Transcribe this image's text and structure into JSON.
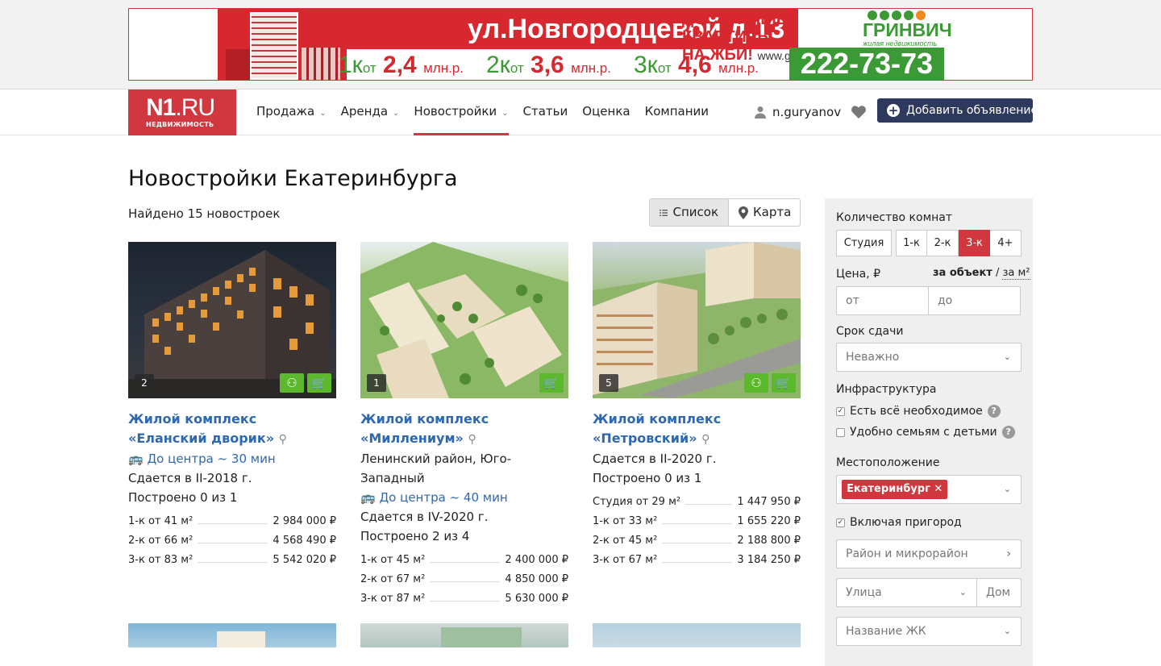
{
  "banner": {
    "address": "ул.Новгородцевой д.13",
    "promo_line1": "ДОСТУПНЫЕ КВАРТИРЫ",
    "promo_line2": "НА ЖБИ!",
    "url": "www.grinvich.ru",
    "brand": "ГРИНВИЧ",
    "brand_sub": "жилая недвижимость",
    "phone": "222-73-73",
    "prices": [
      {
        "rooms": "1к",
        "from": "от",
        "value": "2,4",
        "unit": "млн.р."
      },
      {
        "rooms": "2к",
        "from": "от",
        "value": "3,6",
        "unit": "млн.р."
      },
      {
        "rooms": "3к",
        "from": "от",
        "value": "4,6",
        "unit": "млн.р."
      }
    ]
  },
  "nav": {
    "logo_main": "N1",
    "logo_ru": ".RU",
    "logo_sub": "НЕДВИЖИМОСТЬ",
    "items": [
      {
        "label": "Продажа",
        "dropdown": true
      },
      {
        "label": "Аренда",
        "dropdown": true
      },
      {
        "label": "Новостройки",
        "dropdown": true,
        "active": true
      },
      {
        "label": "Статьи"
      },
      {
        "label": "Оценка"
      },
      {
        "label": "Компании"
      }
    ],
    "username": "n.guryanov",
    "add_button": "Добавить объявление"
  },
  "page": {
    "title": "Новостройки Екатеринбурга",
    "found": "Найдено 15 новостроек",
    "view_list": "Список",
    "view_map": "Карта"
  },
  "cards": [
    {
      "photo_count": "2",
      "name": "Жилой комплекс «Еланский дворик»",
      "district": "",
      "to_center": "До центра ~ 30 мин",
      "delivery": "Сдается в II-2018 г.",
      "built": "Построено 0 из 1",
      "prices": [
        {
          "label": "1-к от 41 м²",
          "price": "2 984 000 ₽"
        },
        {
          "label": "2-к от 66 м²",
          "price": "4 568 490 ₽"
        },
        {
          "label": "3-к от 83 м²",
          "price": "5 542 020 ₽"
        }
      ]
    },
    {
      "photo_count": "1",
      "name": "Жилой комплекс «Миллениум»",
      "district": "Ленинский район, Юго-Западный",
      "to_center": "До центра ~ 40 мин",
      "delivery": "Сдается в IV-2020 г.",
      "built": "Построено 2 из 4",
      "prices": [
        {
          "label": "1-к от 45 м²",
          "price": "2 400 000 ₽"
        },
        {
          "label": "2-к от 67 м²",
          "price": "4 850 000 ₽"
        },
        {
          "label": "3-к от 87 м²",
          "price": "5 630 000 ₽"
        }
      ]
    },
    {
      "photo_count": "5",
      "name": "Жилой комплекс «Петровский»",
      "district": "",
      "to_center": "",
      "delivery": "Сдается в II-2020 г.",
      "built": "Построено 0 из 1",
      "prices": [
        {
          "label": "Студия от 29 м²",
          "price": "1 447 950 ₽"
        },
        {
          "label": "1-к от 33 м²",
          "price": "1 655 220 ₽"
        },
        {
          "label": "2-к от 45 м²",
          "price": "2 188 800 ₽"
        },
        {
          "label": "3-к от 67 м²",
          "price": "3 184 250 ₽"
        }
      ]
    }
  ],
  "filter": {
    "rooms_label": "Количество комнат",
    "rooms": [
      "Студия",
      "1-к",
      "2-к",
      "3-к",
      "4+"
    ],
    "rooms_selected": "3-к",
    "price_label": "Цена, ₽",
    "price_per_object": "за объект",
    "price_sep": "/",
    "price_per_m2": "за м²",
    "price_from": "от",
    "price_to": "до",
    "deadline_label": "Срок сдачи",
    "deadline_value": "Неважно",
    "infra_label": "Инфраструктура",
    "infra_all": "Есть всё необходимое",
    "infra_family": "Удобно семьям с детьми",
    "location_label": "Местоположение",
    "location_tag": "Екатеринбург",
    "suburb": "Включая пригород",
    "district_placeholder": "Район и микрорайон",
    "street_placeholder": "Улица",
    "house_placeholder": "Дом",
    "complex_placeholder": "Название ЖК"
  }
}
